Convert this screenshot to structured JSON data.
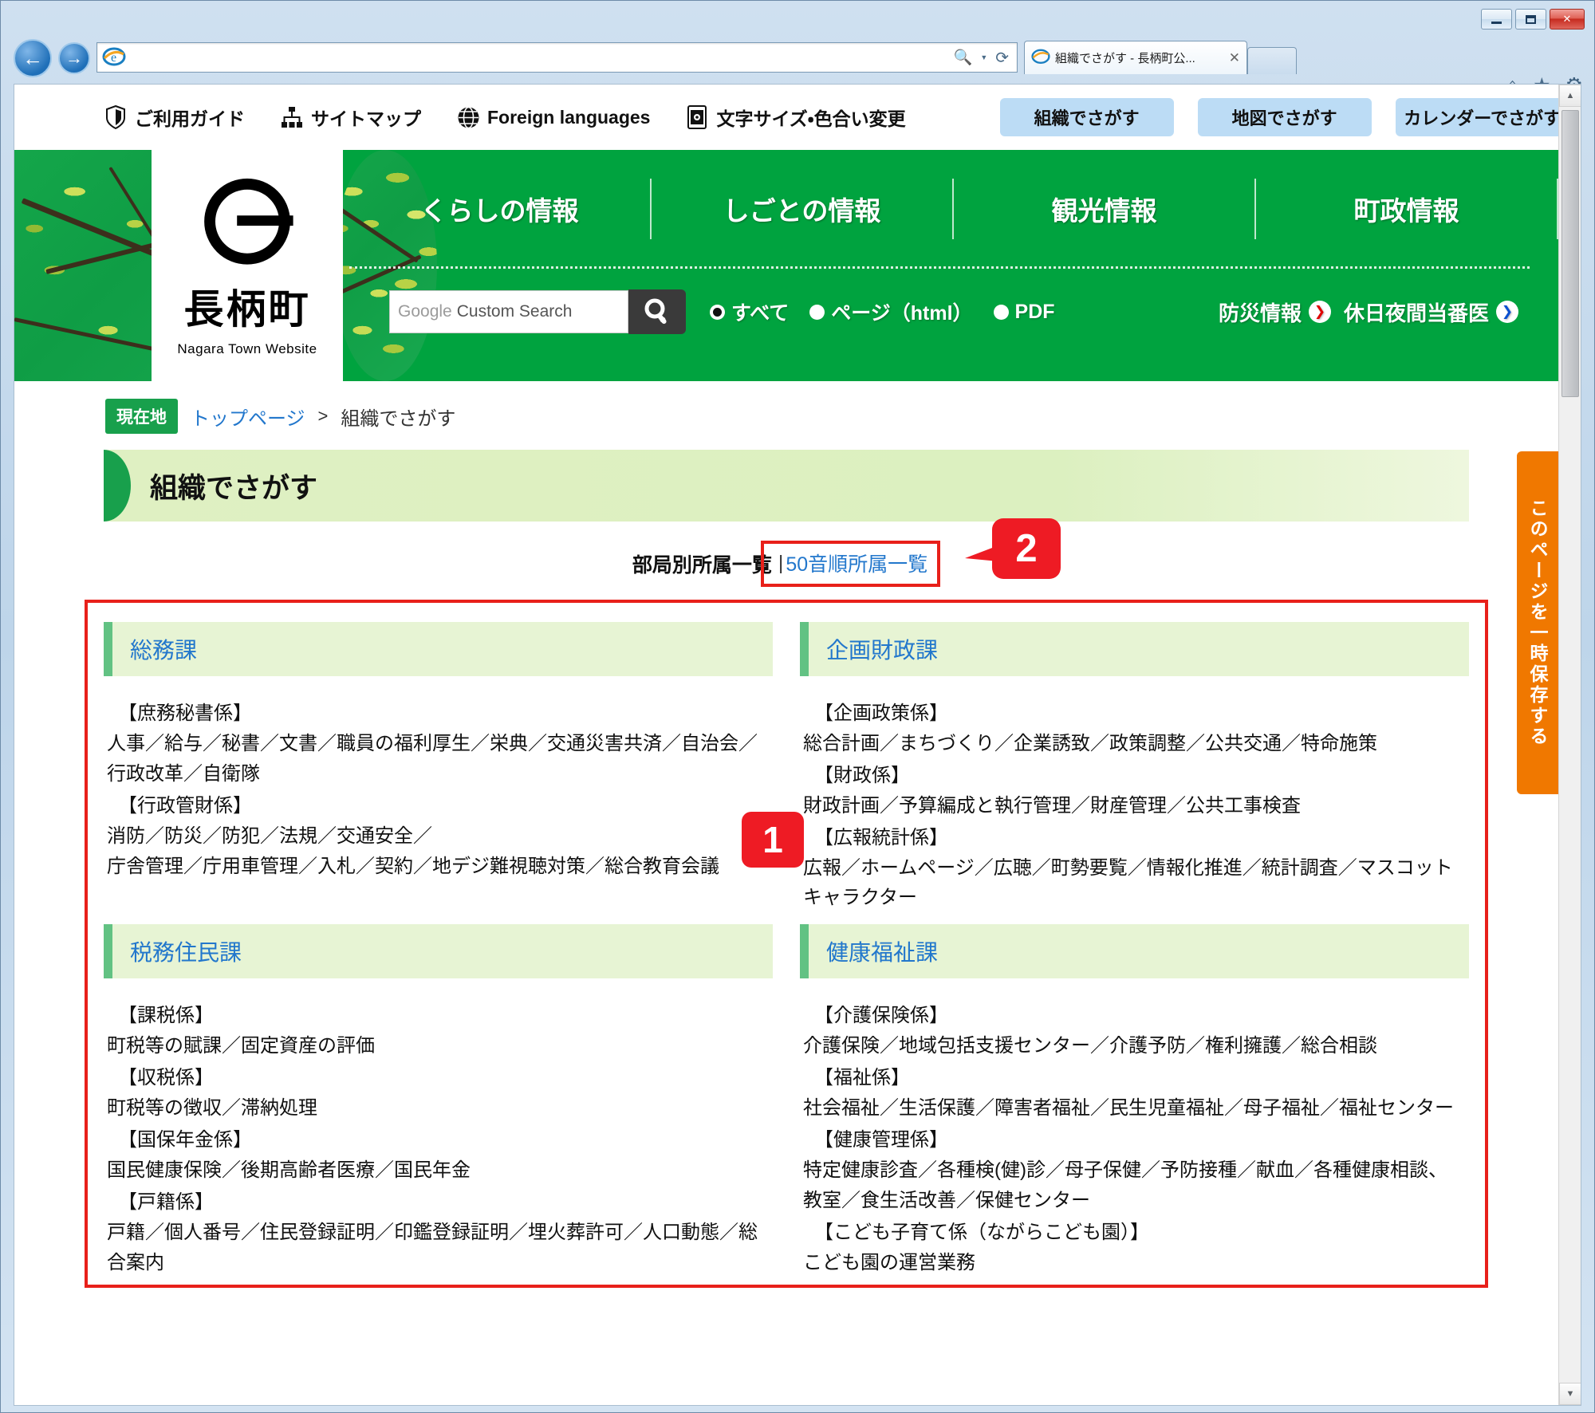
{
  "browser": {
    "tab_title": "組織でさがす - 長柄町公...",
    "address_value": "",
    "tab_close_label": "✕",
    "window_controls": {
      "minimize": "—",
      "maximize": "❐",
      "close": "✕"
    }
  },
  "utility": {
    "links": [
      {
        "label": "ご利用ガイド",
        "icon": "shield-guide-icon"
      },
      {
        "label": "サイトマップ",
        "icon": "sitemap-icon"
      },
      {
        "label": "Foreign languages",
        "icon": "globe-icon"
      },
      {
        "label": "文字サイズ・色合い変更",
        "icon": "display-settings-icon"
      }
    ],
    "buttons": [
      "組織でさがす",
      "地図でさがす",
      "カレンダーでさがす"
    ]
  },
  "brand": {
    "name": "長柄町",
    "subtitle": "Nagara Town Website"
  },
  "global_nav": [
    "くらしの情報",
    "しごとの情報",
    "観光情報",
    "町政情報"
  ],
  "search": {
    "placeholder_brand": "Google",
    "placeholder_text": "Custom Search",
    "icon": "search-icon",
    "radios": [
      {
        "label": "すべて",
        "selected": true
      },
      {
        "label": "ページ（html）",
        "selected": false
      },
      {
        "label": "PDF",
        "selected": false
      }
    ]
  },
  "emergency_links": [
    {
      "label": "防災情報",
      "arrow_color": "#e00000"
    },
    {
      "label": "休日夜間当番医",
      "arrow_color": "#0a4fd0"
    }
  ],
  "save_tab": {
    "label": "このページを一時保存する",
    "color": "#f07800"
  },
  "breadcrumb": {
    "badge": "現在地",
    "home": "トップページ",
    "separator": ">",
    "current": "組織でさがす"
  },
  "page_title": "組織でさがす",
  "tab_links": {
    "active": "部局別所属一覧",
    "pipe": "|",
    "link": "50音順所属一覧"
  },
  "annotations": [
    {
      "number": "1",
      "color": "#ee1b24"
    },
    {
      "number": "2",
      "color": "#ee1b24"
    }
  ],
  "departments": [
    {
      "name": "総務課",
      "sections": [
        {
          "title": "【庶務秘書係】",
          "items": "人事／給与／秘書／文書／職員の福利厚生／栄典／交通災害共済／自治会／行政改革／自衛隊"
        },
        {
          "title": "【行政管財係】",
          "items": "消防／防災／防犯／法規／交通安全／\n庁舎管理／庁用車管理／入札／契約／地デジ難視聴対策／総合教育会議"
        }
      ]
    },
    {
      "name": "企画財政課",
      "sections": [
        {
          "title": "【企画政策係】",
          "items": "総合計画／まちづくり／企業誘致／政策調整／公共交通／特命施策"
        },
        {
          "title": "【財政係】",
          "items": "財政計画／予算編成と執行管理／財産管理／公共工事検査"
        },
        {
          "title": "【広報統計係】",
          "items": "広報／ホームページ／広聴／町勢要覧／情報化推進／統計調査／マスコットキャラクター"
        }
      ]
    },
    {
      "name": "税務住民課",
      "sections": [
        {
          "title": "【課税係】",
          "items": "町税等の賦課／固定資産の評価"
        },
        {
          "title": "【収税係】",
          "items": "町税等の徴収／滞納処理"
        },
        {
          "title": "【国保年金係】",
          "items": "国民健康保険／後期高齢者医療／国民年金"
        },
        {
          "title": "【戸籍係】",
          "items": "戸籍／個人番号／住民登録証明／印鑑登録証明／埋火葬許可／人口動態／総合案内"
        }
      ]
    },
    {
      "name": "健康福祉課",
      "sections": [
        {
          "title": "【介護保険係】",
          "items": "介護保険／地域包括支援センター／介護予防／権利擁護／総合相談"
        },
        {
          "title": "【福祉係】",
          "items": "社会福祉／生活保護／障害者福祉／民生児童福祉／母子福祉／福祉センター"
        },
        {
          "title": "【健康管理係】",
          "items": "特定健康診査／各種検(健)診／母子保健／予防接種／献血／各種健康相談、教室／食生活改善／保健センター"
        },
        {
          "title": "【こども子育て係（ながらこども園）】",
          "items": "こども園の運営業務"
        }
      ]
    }
  ],
  "scrollbar": {
    "up_arrow": "▲",
    "down_arrow": "▼"
  }
}
